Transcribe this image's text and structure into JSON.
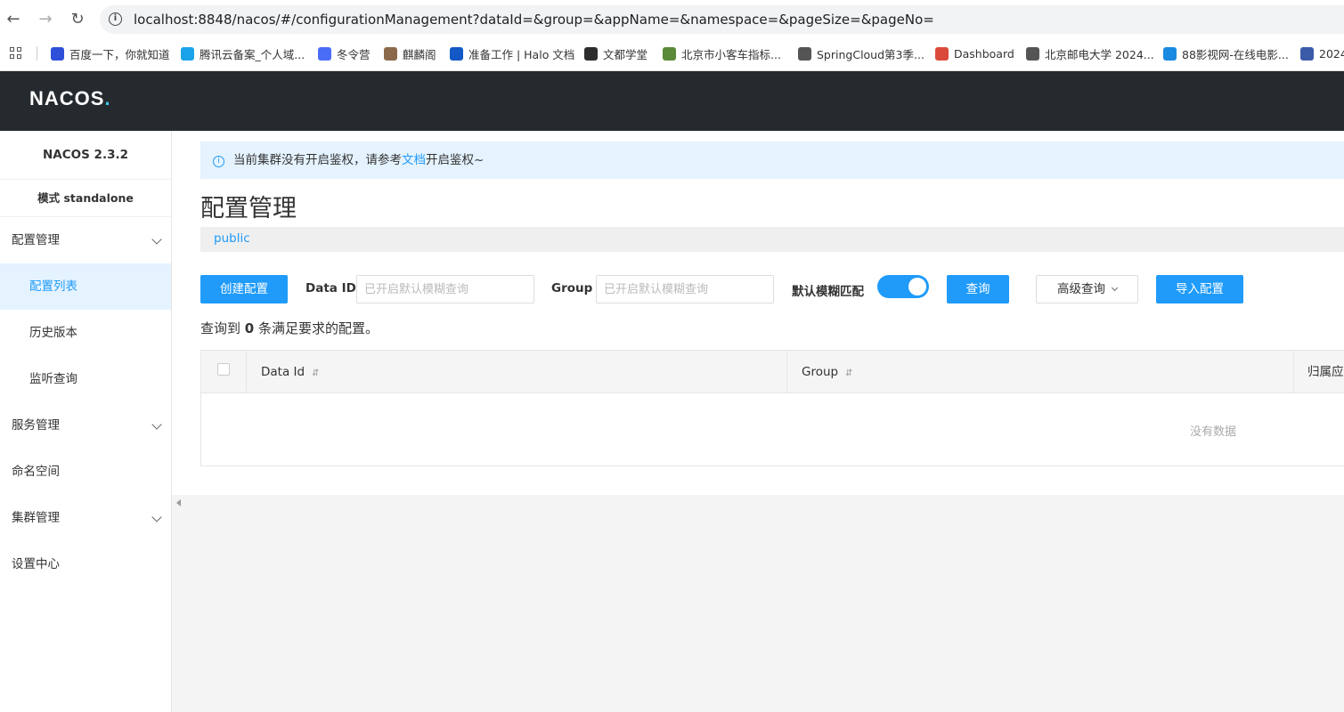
{
  "browser": {
    "url": "localhost:8848/nacos/#/configurationManagement?dataId=&group=&appName=&namespace=&pageSize=&pageNo=",
    "bookmarks": [
      {
        "label": "百度一下，你就知道",
        "icon": "baidu-icon",
        "color": "#2e4fd8"
      },
      {
        "label": "腾讯云备案_个人域...",
        "icon": "cloud-icon",
        "color": "#1aa3e8"
      },
      {
        "label": "冬令营",
        "icon": "pen-icon",
        "color": "#4a6cf7"
      },
      {
        "label": "麒麟阁",
        "icon": "photo-icon",
        "color": "#8a6a4a"
      },
      {
        "label": "准备工作 | Halo 文档",
        "icon": "halo-icon",
        "color": "#1358c4"
      },
      {
        "label": "文都学堂",
        "icon": "wendu-icon",
        "color": "#2d2d2d"
      },
      {
        "label": "北京市小客车指标...",
        "icon": "badge-icon",
        "color": "#5a8a3a"
      },
      {
        "label": "SpringCloud第3季...",
        "icon": "doc-icon",
        "color": "#555555"
      },
      {
        "label": "Dashboard",
        "icon": "dashboard-icon",
        "color": "#d94a3a"
      },
      {
        "label": "北京邮电大学 2024...",
        "icon": "globe-icon",
        "color": "#555555"
      },
      {
        "label": "88影视网-在线电影...",
        "icon": "eighty-eight-icon",
        "color": "#1a8ae0"
      },
      {
        "label": "2024",
        "icon": "wheel-icon",
        "color": "#3b5ba9"
      }
    ]
  },
  "header": {
    "logo_main": "NACOS",
    "logo_dot": "."
  },
  "sidebar": {
    "version": "NACOS 2.3.2",
    "mode": "模式 standalone",
    "items": [
      {
        "label": "配置管理",
        "type": "top",
        "expandable": true
      },
      {
        "label": "配置列表",
        "type": "sub",
        "active": true
      },
      {
        "label": "历史版本",
        "type": "sub"
      },
      {
        "label": "监听查询",
        "type": "sub"
      },
      {
        "label": "服务管理",
        "type": "top",
        "expandable": true
      },
      {
        "label": "命名空间",
        "type": "top"
      },
      {
        "label": "集群管理",
        "type": "top",
        "expandable": true
      },
      {
        "label": "设置中心",
        "type": "top"
      }
    ]
  },
  "notice": {
    "prefix": "当前集群没有开启鉴权，请参考",
    "link": "文档",
    "suffix": "开启鉴权~"
  },
  "page": {
    "title": "配置管理",
    "namespace": "public",
    "create_button": "创建配置",
    "dataid_label": "Data ID",
    "dataid_placeholder": "已开启默认模糊查询",
    "group_label": "Group",
    "group_placeholder": "已开启默认模糊查询",
    "fuzzy_label": "默认模糊匹配",
    "fuzzy_on": true,
    "search_button": "查询",
    "advanced_button": "高级查询",
    "import_button": "导入配置",
    "result_prefix": "查询到",
    "result_count": "0",
    "result_suffix": "条满足要求的配置。"
  },
  "table": {
    "columns": [
      "Data Id",
      "Group",
      "归属应"
    ],
    "empty_text": "没有数据",
    "sort_icon": "sort-icon",
    "accent": "#209bfa"
  }
}
